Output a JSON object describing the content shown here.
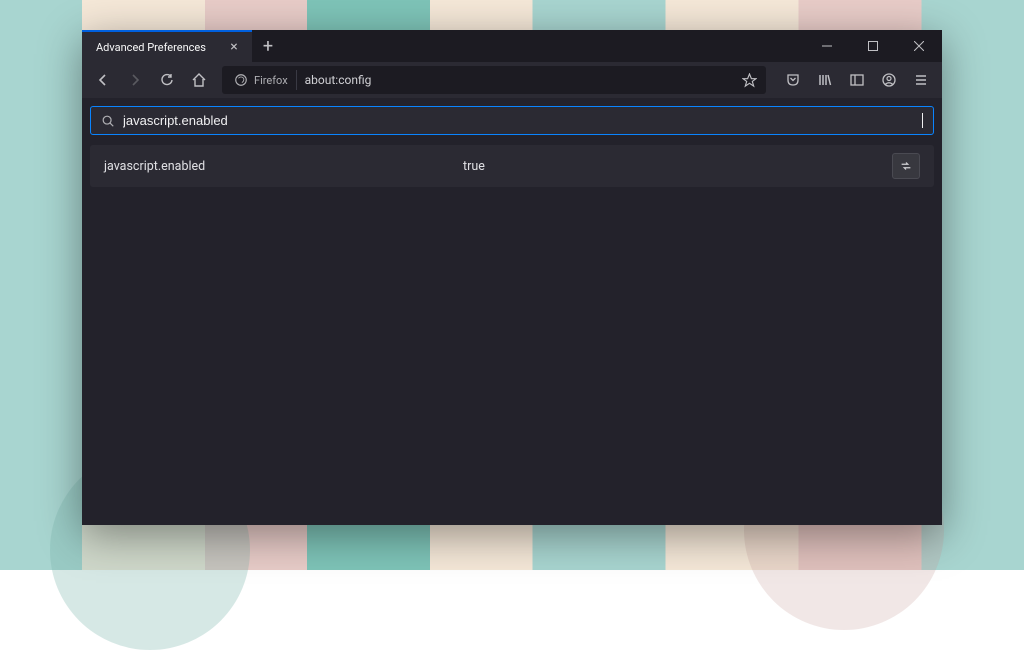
{
  "browser": {
    "name": "Firefox",
    "tab": {
      "title": "Advanced Preferences"
    },
    "url": "about:config"
  },
  "config": {
    "search_value": "javascript.enabled",
    "results": [
      {
        "name": "javascript.enabled",
        "value": "true"
      }
    ]
  }
}
